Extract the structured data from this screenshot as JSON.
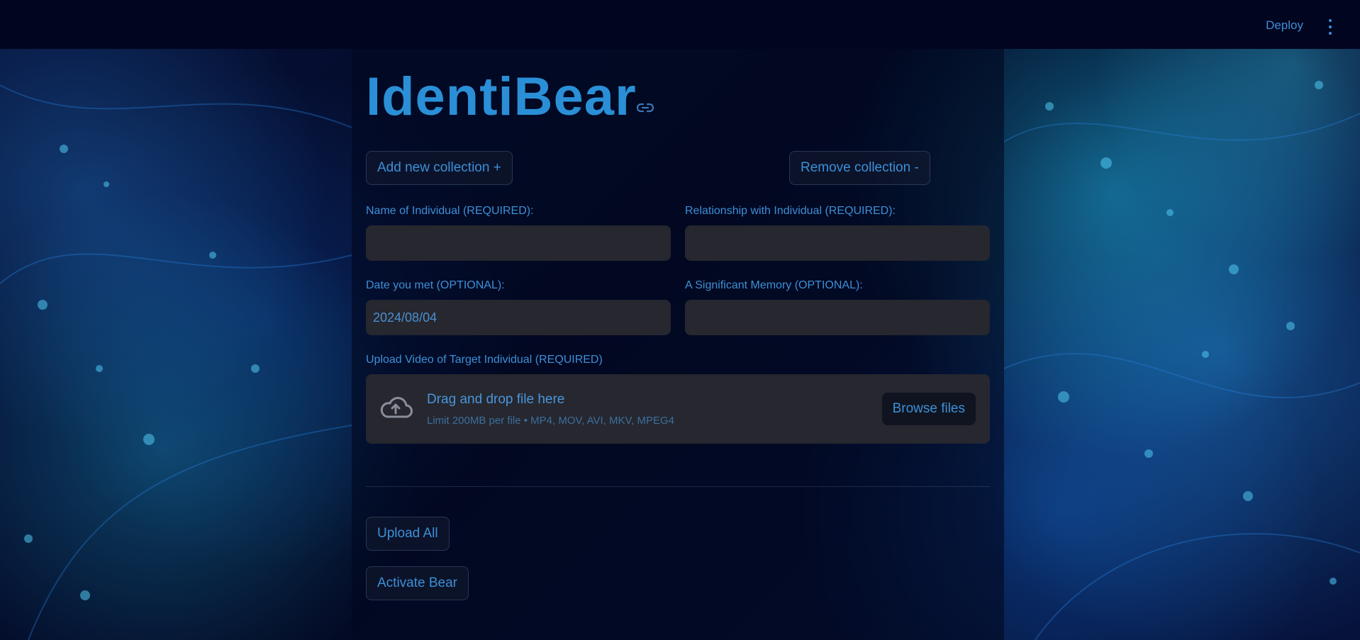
{
  "header": {
    "deploy_label": "Deploy",
    "menu_icon": "kebab-menu-icon"
  },
  "app": {
    "title": "IdentiBear",
    "anchor_icon": "link-icon"
  },
  "collection": {
    "add_label": "Add new collection +",
    "remove_label": "Remove collection -"
  },
  "form": {
    "name_label": "Name of Individual (REQUIRED):",
    "name_value": "",
    "relationship_label": "Relationship with Individual (REQUIRED):",
    "relationship_value": "",
    "date_label": "Date you met (OPTIONAL):",
    "date_value": "2024/08/04",
    "memory_label": "A Significant Memory (OPTIONAL):",
    "memory_value": ""
  },
  "upload": {
    "label": "Upload Video of Target Individual (REQUIRED)",
    "icon": "cloud-upload-icon",
    "drop_title": "Drag and drop file here",
    "drop_subtitle": "Limit 200MB per file • MP4, MOV, AVI, MKV, MPEG4",
    "browse_label": "Browse files"
  },
  "actions": {
    "upload_all_label": "Upload All",
    "activate_label": "Activate Bear"
  },
  "colors": {
    "accent": "#3d8fd6",
    "title": "#2a8fd6",
    "input_bg": "#26272f",
    "page_bg": "#02061a"
  }
}
